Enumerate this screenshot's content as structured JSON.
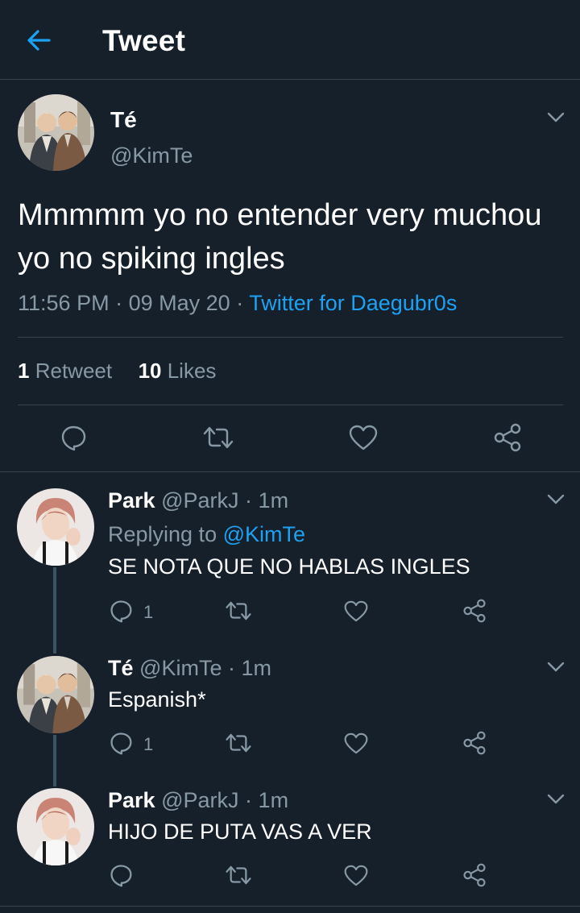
{
  "header": {
    "title": "Tweet",
    "back_icon": "arrow-left-icon"
  },
  "colors": {
    "background": "#15202b",
    "accent": "#1da1f2",
    "muted": "#8899a6",
    "divider": "#38444d"
  },
  "main_tweet": {
    "name": "Té",
    "handle": "@KimTe",
    "text": "Mmmmm yo no entender very muchou yo no spiking ingles",
    "time": "11:56 PM",
    "date": "09 May 20",
    "separator": "·",
    "source": "Twitter for Daegubr0s",
    "retweet_count": "1",
    "retweet_label": "Retweet",
    "like_count": "10",
    "like_label": "Likes"
  },
  "replies": [
    {
      "name": "Park",
      "handle": "@ParkJ",
      "separator": "·",
      "time": "1m",
      "replying_label": "Replying to",
      "replying_to": "@KimTe",
      "text": "SE NOTA QUE NO HABLAS INGLES",
      "reply_count": "1"
    },
    {
      "name": "Té",
      "handle": "@KimTe",
      "separator": "·",
      "time": "1m",
      "text": "Espanish*",
      "reply_count": "1"
    },
    {
      "name": "Park",
      "handle": "@ParkJ",
      "separator": "·",
      "time": "1m",
      "text": "HIJO DE PUTA VAS A VER",
      "reply_count": ""
    }
  ]
}
